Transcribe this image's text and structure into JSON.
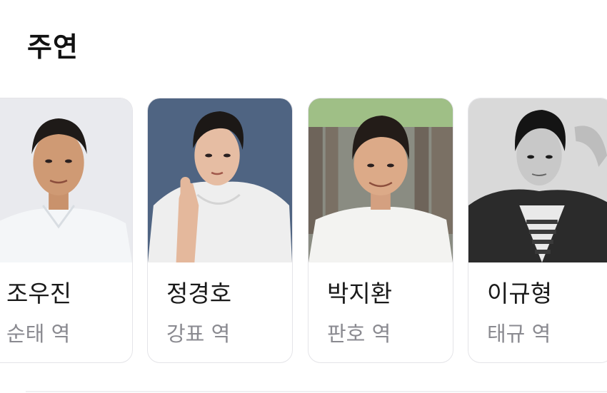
{
  "section": {
    "title": "주연"
  },
  "cast": [
    {
      "name": "조우진",
      "role": "순태 역",
      "photo_bg": "#e9eaee",
      "shirt": "#f4f6f8"
    },
    {
      "name": "정경호",
      "role": "강표 역",
      "photo_bg": "#4f6482",
      "shirt": "#eeeeee"
    },
    {
      "name": "박지환",
      "role": "판호 역",
      "photo_bg": "#8a8c82",
      "shirt": "#f3f3f1"
    },
    {
      "name": "이규형",
      "role": "태규 역",
      "photo_bg": "#d9d9d9",
      "shirt": "#2b2b2b"
    }
  ]
}
